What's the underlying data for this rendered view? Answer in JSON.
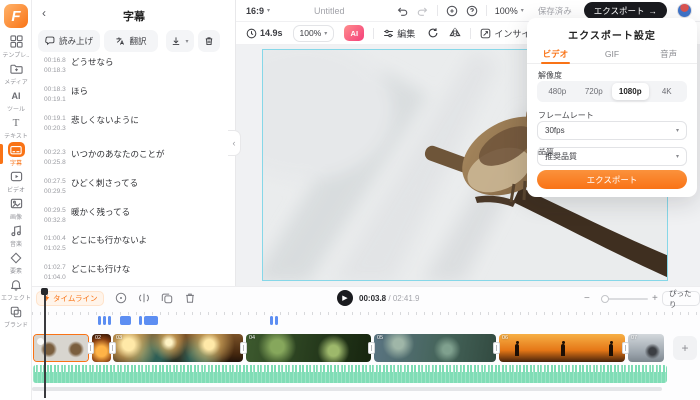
{
  "colors": {
    "accent": "#f97316",
    "export_black": "#1a1b1f",
    "waveform_green": "#6fd9ac",
    "subtitle_segment_blue": "#5d8ef2",
    "canvas_border_cyan": "#86d7e8"
  },
  "sidebar": {
    "items": [
      {
        "label": "テンプレ..",
        "icon": "template-icon"
      },
      {
        "label": "メディア",
        "icon": "media-icon"
      },
      {
        "label": "ツール",
        "icon": "ai-tools-icon"
      },
      {
        "label": "テキスト",
        "icon": "text-icon"
      },
      {
        "label": "字幕",
        "icon": "subtitles-icon",
        "active": true
      },
      {
        "label": "ビデオ",
        "icon": "video-icon"
      },
      {
        "label": "画像",
        "icon": "image-icon"
      },
      {
        "label": "音楽",
        "icon": "music-icon"
      },
      {
        "label": "要素",
        "icon": "elements-icon"
      },
      {
        "label": "エフェクト",
        "icon": "effects-icon"
      },
      {
        "label": "ブランド",
        "icon": "brand-icon"
      }
    ]
  },
  "subtitle_panel": {
    "title": "字幕",
    "read_aloud_label": "読み上げ",
    "translate_label": "翻訳",
    "subtitles": [
      {
        "start": "00:16.8",
        "end": "00:18.3",
        "text": "どうせなら"
      },
      {
        "start": "00:18.3",
        "end": "00:19.1",
        "text": "ほら"
      },
      {
        "start": "00:19.1",
        "end": "00:20.3",
        "text": "悲しくないように"
      },
      {
        "start": "00:22.3",
        "end": "00:25.8",
        "text": "いつかのあなたのことが"
      },
      {
        "start": "00:27.5",
        "end": "00:29.5",
        "text": "ひどく刺さってる"
      },
      {
        "start": "00:29.5",
        "end": "00:32.8",
        "text": "暖かく残ってる"
      },
      {
        "start": "01:00.4",
        "end": "01:02.5",
        "text": "どこにも行かないよ"
      },
      {
        "start": "01:02.7",
        "end": "01:04.0",
        "text": "どこにも行けな"
      }
    ]
  },
  "top_bar": {
    "ratio": "16:9",
    "project_title": "Untitled",
    "zoom": "100%",
    "saved_status": "保存済み",
    "export_label": "エクスポート",
    "export_arrow": "→"
  },
  "preview_toolbar": {
    "duration": "14.9s",
    "zoom": "100%",
    "ai_label": "AI",
    "edit_label": "編集",
    "motion_label": "インサイド・モーション"
  },
  "export_popup": {
    "title": "エクスポート設定",
    "tabs": [
      "ビデオ",
      "GIF",
      "音声"
    ],
    "active_tab": "ビデオ",
    "resolution_label": "解像度",
    "resolutions": [
      "480p",
      "720p",
      "1080p",
      "4K"
    ],
    "selected_resolution": "1080p",
    "framerate_label": "フレームレート",
    "framerate_value": "30fps",
    "quality_label": "品質",
    "quality_value": "推奨品質",
    "export_button": "エクスポート"
  },
  "timeline": {
    "toggle_label": "タイムライン",
    "current_time": "00:03.8",
    "separator": " / ",
    "total_time": "02:41.9",
    "fit_label": "ぴったり",
    "clip_labels": [
      "02",
      "03",
      "04",
      "05",
      "06",
      "07"
    ]
  }
}
